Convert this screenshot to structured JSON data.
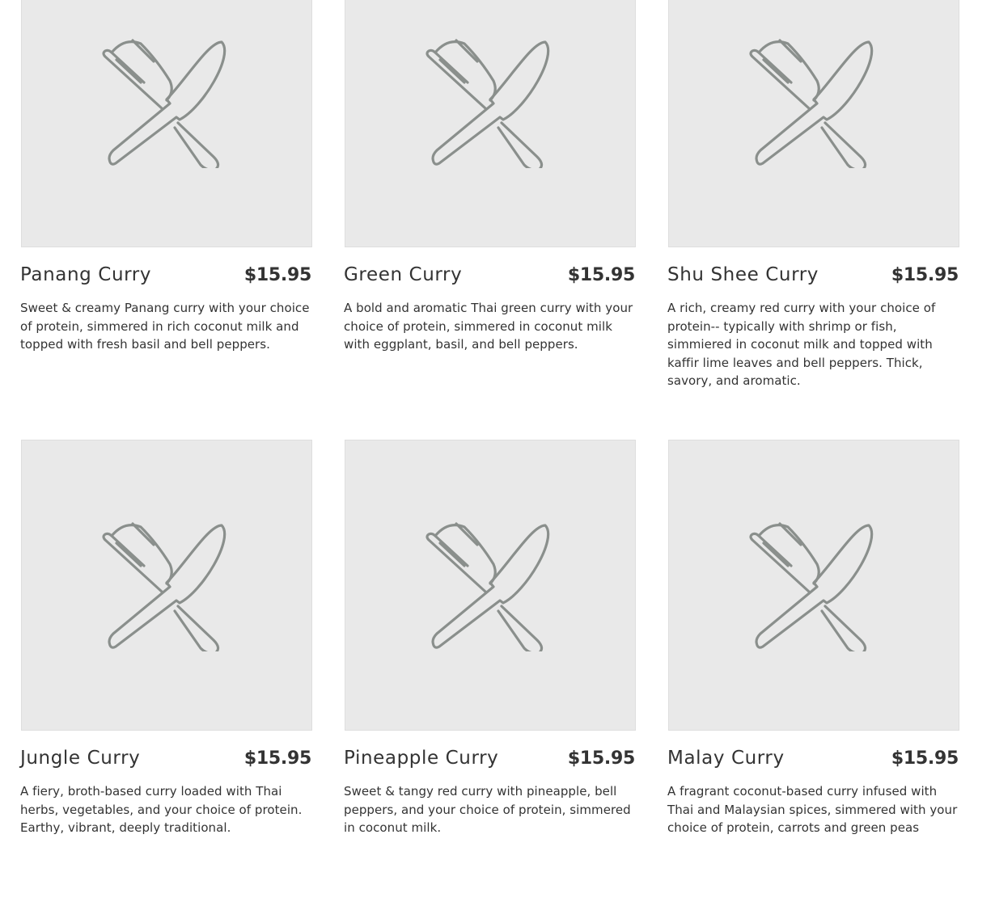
{
  "menu": {
    "items": [
      {
        "name": "Panang Curry",
        "price": "$15.95",
        "description": "Sweet & creamy Panang curry with your choice of protein, simmered in rich coconut milk and topped with fresh basil and bell peppers.",
        "image_icon": "fork-knife-placeholder-icon"
      },
      {
        "name": "Green Curry",
        "price": "$15.95",
        "description": "A bold and aromatic Thai green curry with your choice of protein, simmered in coconut milk with eggplant, basil, and bell peppers.",
        "image_icon": "fork-knife-placeholder-icon"
      },
      {
        "name": "Shu Shee Curry",
        "price": "$15.95",
        "description": "A rich, creamy red curry with your choice of protein-- typically with shrimp or fish, simmiered in coconut milk and topped with kaffir lime leaves and bell peppers. Thick, savory, and aromatic.",
        "image_icon": "fork-knife-placeholder-icon"
      },
      {
        "name": "Jungle Curry",
        "price": "$15.95",
        "description": "A fiery, broth-based curry loaded with Thai herbs, vegetables, and your choice of protein. Earthy, vibrant, deeply traditional.",
        "image_icon": "fork-knife-placeholder-icon"
      },
      {
        "name": "Pineapple Curry",
        "price": "$15.95",
        "description": "Sweet & tangy red curry with pineapple, bell peppers, and your choice of protein, simmered in coconut milk.",
        "image_icon": "fork-knife-placeholder-icon"
      },
      {
        "name": "Malay Curry",
        "price": "$15.95",
        "description": "A fragrant coconut-based curry infused with Thai and Malaysian spices, simmered with your choice of protein, carrots and green peas",
        "image_icon": "fork-knife-placeholder-icon"
      }
    ]
  },
  "colors": {
    "placeholder_bg": "#e9e9e9",
    "icon_stroke": "#8a8f8c",
    "text": "#333333"
  }
}
